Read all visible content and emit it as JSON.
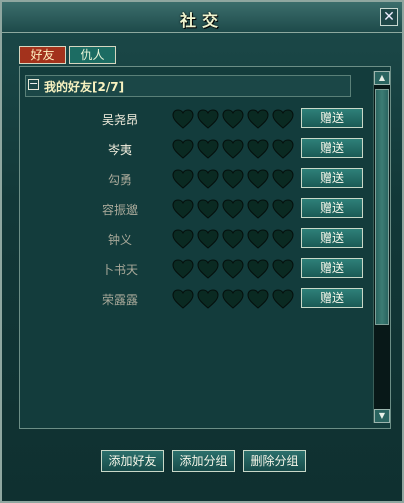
{
  "window": {
    "title": "社交",
    "close_label": "✕"
  },
  "tabs": [
    {
      "label": "好友",
      "active": true
    },
    {
      "label": "仇人",
      "active": false
    }
  ],
  "group": {
    "collapse_symbol": "−",
    "title": "我的好友[2/7]"
  },
  "friends": [
    {
      "name": "吴尧昂",
      "name_color": "#f5f0e0",
      "hearts": 0,
      "gift_label": "赠送"
    },
    {
      "name": "岑夷",
      "name_color": "#f5f0e0",
      "hearts": 0,
      "gift_label": "赠送"
    },
    {
      "name": "勾勇",
      "name_color": "#a9a99a",
      "hearts": 0,
      "gift_label": "赠送"
    },
    {
      "name": "容振邈",
      "name_color": "#a9a99a",
      "hearts": 0,
      "gift_label": "赠送"
    },
    {
      "name": "钟义",
      "name_color": "#a9a99a",
      "hearts": 0,
      "gift_label": "赠送"
    },
    {
      "name": "卜书天",
      "name_color": "#a9a99a",
      "hearts": 0,
      "gift_label": "赠送"
    },
    {
      "name": "荣露露",
      "name_color": "#a9a99a",
      "hearts": 0,
      "gift_label": "赠送"
    }
  ],
  "hearts_max": 5,
  "colors": {
    "heart_empty": "#0a2a22",
    "heart_outline": "#050f0c"
  },
  "scrollbar": {
    "up_icon": "▲",
    "down_icon": "▼"
  },
  "buttons": {
    "add_friend": "添加好友",
    "add_group": "添加分组",
    "delete_group": "删除分组"
  }
}
